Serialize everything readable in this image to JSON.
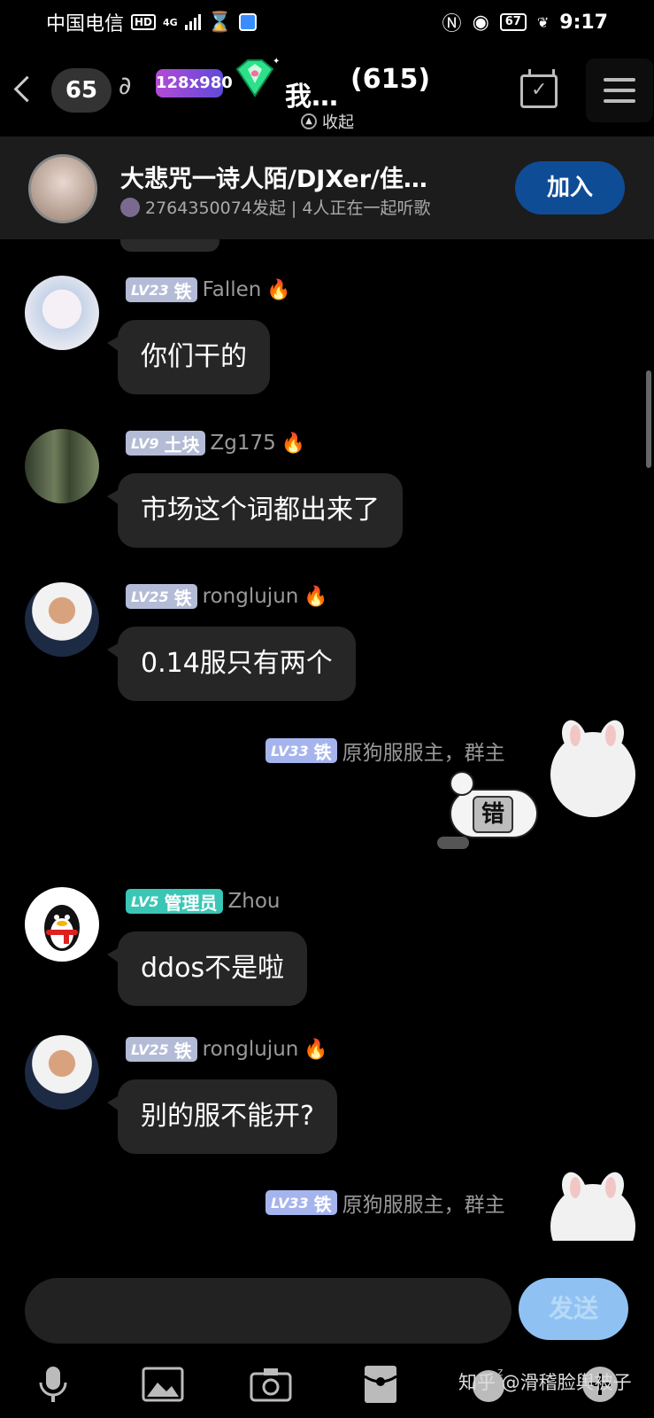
{
  "status_bar": {
    "carrier": "中国电信",
    "hd_badge": "HD",
    "network": "4G",
    "battery": "67",
    "time": "9:17"
  },
  "header": {
    "unread_count": "65",
    "level_badge": "128x980",
    "title": "我…",
    "member_count": "(615)",
    "collapse_label": "收起"
  },
  "listening": {
    "title": "大悲咒一诗人陌/DJXer/佳…",
    "subtitle": "2764350074发起 | 4人正在一起听歌",
    "join_label": "加入"
  },
  "messages": [
    {
      "lv": "LV23",
      "tag": "铁",
      "nick": "Fallen",
      "fire": true,
      "text": "你们干的",
      "avatar": "anime-girl-avatar"
    },
    {
      "lv": "LV9",
      "tag": "土块",
      "nick": "Zg175",
      "fire": true,
      "text": "市场这个词都出来了",
      "avatar": "forest-avatar"
    },
    {
      "lv": "LV25",
      "tag": "铁",
      "nick": "ronglujun",
      "fire": true,
      "text": "0.14服只有两个",
      "avatar": "man-suit-avatar"
    },
    {
      "lv": "LV5",
      "tag": "管理员",
      "nick": "Zhou",
      "fire": false,
      "text": "ddos不是啦",
      "avatar": "qq-penguin-avatar"
    },
    {
      "lv": "LV25",
      "tag": "铁",
      "nick": "ronglujun",
      "fire": true,
      "text": "别的服不能开?",
      "avatar": "man-suit-avatar"
    }
  ],
  "owner": {
    "lv": "LV33",
    "tag": "铁",
    "nick": "原狗服服主，群主",
    "sticker_text": "错"
  },
  "input": {
    "placeholder": "",
    "send_label": "发送"
  },
  "watermark": "知乎 @滑稽脸舆被子",
  "colors": {
    "background": "#000000",
    "bubble": "#262626",
    "join_button": "#0f4c96",
    "send_button": "#8fc2f3",
    "admin_badge": "#3ac6b5",
    "level_badge": "#b3bbd6"
  }
}
